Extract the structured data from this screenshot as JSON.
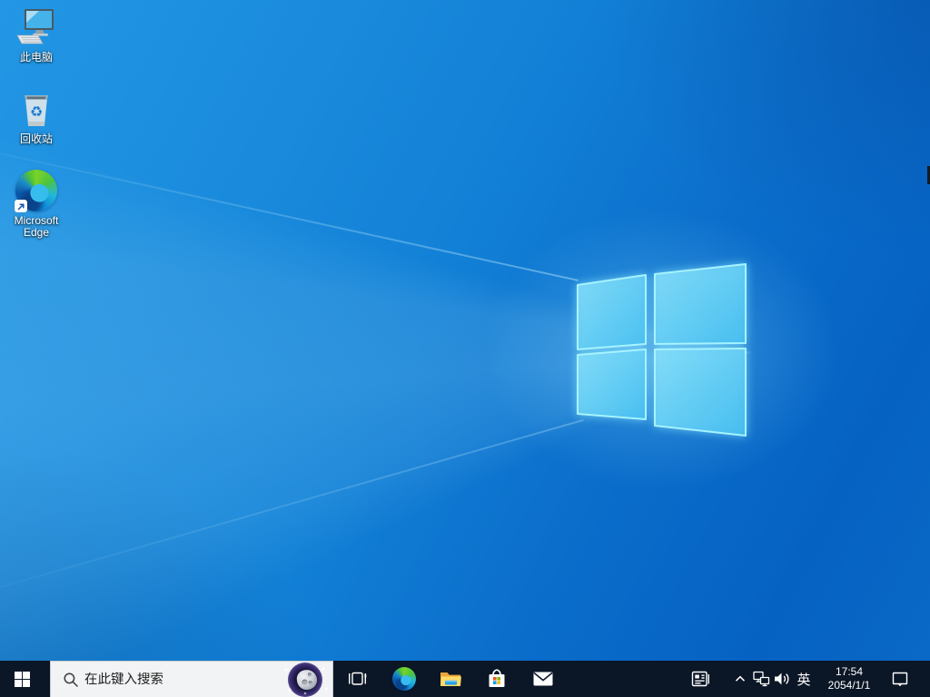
{
  "desktop": {
    "icons": [
      {
        "id": "this-pc",
        "icon": "computer-icon",
        "label": "此电脑"
      },
      {
        "id": "recycle-bin",
        "icon": "recycle-bin-icon",
        "label": "回收站"
      },
      {
        "id": "microsoft-edge",
        "icon": "edge-icon",
        "label": "Microsoft Edge"
      }
    ]
  },
  "taskbar": {
    "start": {
      "icon": "windows-logo-icon"
    },
    "search": {
      "placeholder": "在此键入搜索",
      "leading_icon": "search-icon",
      "trailing_icon": "search-highlight-moon-icon"
    },
    "app_buttons": [
      {
        "id": "task-view",
        "icon": "task-view-icon"
      },
      {
        "id": "microsoft-edge",
        "icon": "edge-icon"
      },
      {
        "id": "file-explorer",
        "icon": "folder-icon"
      },
      {
        "id": "microsoft-store",
        "icon": "store-bag-icon"
      },
      {
        "id": "mail",
        "icon": "envelope-icon"
      }
    ],
    "tray": {
      "news_icon": "news-icon",
      "hidden_icons_icon": "chevron-up-icon",
      "network_icon": "ethernet-icon",
      "volume_icon": "speaker-icon",
      "ime_indicator": "英",
      "clock": {
        "time": "17:54",
        "date": "2054/1/1"
      },
      "action_center_icon": "action-center-icon"
    }
  },
  "colors": {
    "taskbar_bg": "#0b1626",
    "search_box_bg": "#f1f3f4",
    "wallpaper_light": "#2aa3e8",
    "wallpaper_deep": "#0562c3",
    "logo_pane_fill": "#55c8f2",
    "logo_pane_edge": "#a5f3ff",
    "ms_red": "#f25022",
    "ms_green": "#7fba00",
    "ms_blue": "#00a4ef",
    "ms_yellow": "#ffb900"
  }
}
